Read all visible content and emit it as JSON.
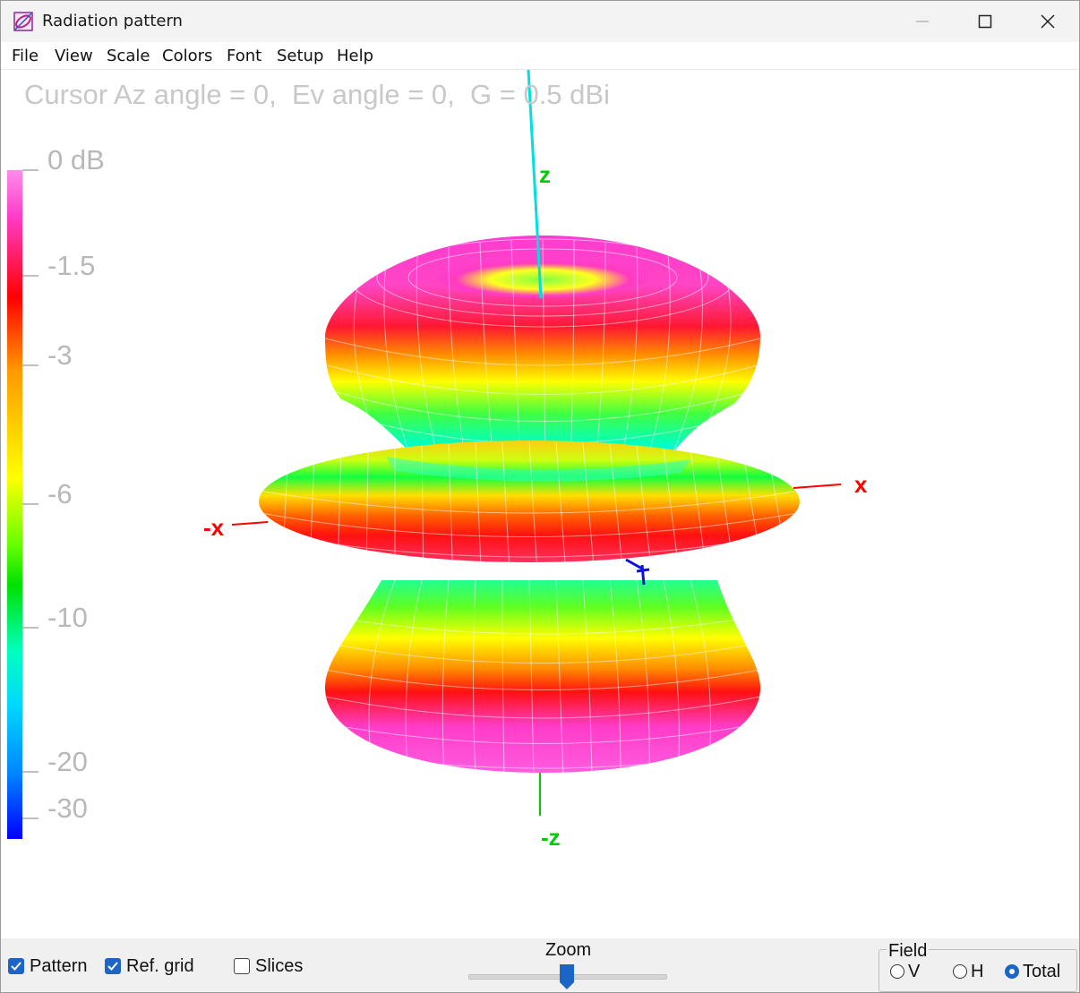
{
  "window": {
    "title": "Radiation pattern"
  },
  "menu": [
    "File",
    "View",
    "Scale",
    "Colors",
    "Font",
    "Setup",
    "Help"
  ],
  "plot": {
    "cursor_readout": "Cursor Az angle = 0,  Ev angle = 0,  G = 0.5 dBi",
    "color_scale": {
      "labels": [
        "0 dB",
        "-1.5",
        "-3",
        "-6",
        "-10",
        "-20",
        "-30"
      ],
      "gradient_colors": [
        "#ff8cec",
        "#ff0000",
        "#ff9900",
        "#ffff00",
        "#00e000",
        "#00ffc0",
        "#00d8ff",
        "#0000ff"
      ]
    },
    "axes": {
      "z": "z",
      "neg_z": "-z",
      "x": "x",
      "neg_x": "-x"
    },
    "axis_colors": {
      "z": "#00e0e0",
      "x": "#ff0000",
      "z_label": "#00cc00",
      "x_label": "#ff0000"
    }
  },
  "controls": {
    "checkboxes": [
      {
        "label": "Pattern",
        "checked": true
      },
      {
        "label": "Ref. grid",
        "checked": true
      },
      {
        "label": "Slices",
        "checked": false
      }
    ],
    "zoom_label": "Zoom",
    "field": {
      "legend": "Field",
      "options": [
        {
          "label": "V",
          "selected": false
        },
        {
          "label": "H",
          "selected": false
        },
        {
          "label": "Total",
          "selected": true
        }
      ]
    }
  },
  "colors": {
    "accent": "#1c64c6"
  }
}
